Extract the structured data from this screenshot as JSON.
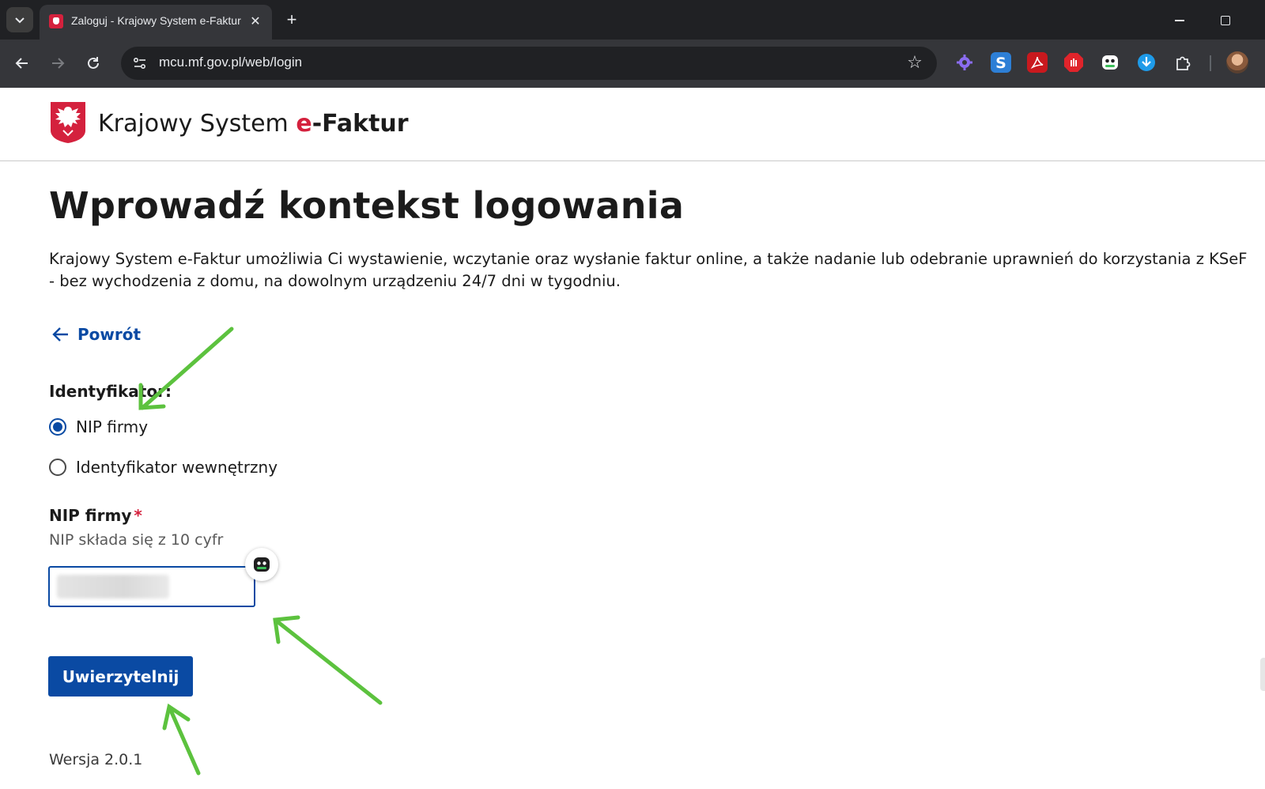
{
  "browser": {
    "tab_title": "Zaloguj - Krajowy System e-Faktur",
    "tab_close_glyph": "✕",
    "new_tab_glyph": "+",
    "url": "mcu.mf.gov.pl/web/login",
    "bookmark_glyph": "☆"
  },
  "header": {
    "title_prefix": "Krajowy System",
    "title_e": "e",
    "title_suffix": "-Faktur"
  },
  "page": {
    "title": "Wprowadź kontekst logowania",
    "intro": "Krajowy System e-Faktur umożliwia Ci wystawienie, wczytanie oraz wysłanie faktur online, a także nadanie lub odebranie uprawnień do korzystania z KSeF - bez wychodzenia z domu, na dowolnym urządzeniu 24/7 dni w tygodniu.",
    "back_label": "Powrót"
  },
  "form": {
    "identifier_label": "Identyfikator:",
    "options": [
      {
        "label": "NIP firmy",
        "checked": true
      },
      {
        "label": "Identyfikator wewnętrzny",
        "checked": false
      }
    ],
    "nip_label": "NIP firmy",
    "required_mark": "*",
    "nip_hint": "NIP składa się z 10 cyfr",
    "nip_value": "",
    "submit_label": "Uwierzytelnij"
  },
  "footer": {
    "version": "Wersja 2.0.1"
  },
  "colors": {
    "accent": "#0a4aa3",
    "brand_red": "#d4213d",
    "annotation_arrow": "#5cc23e"
  }
}
